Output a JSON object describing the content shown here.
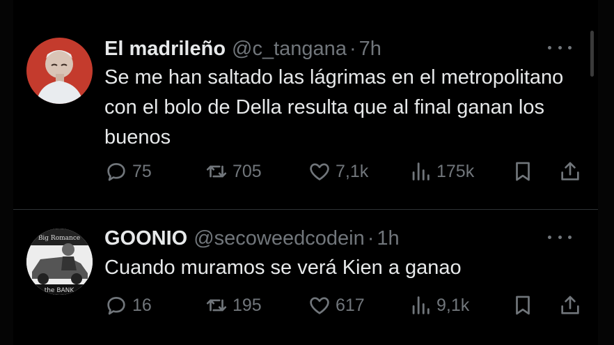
{
  "tweets": [
    {
      "name": "El madrileño",
      "handle": "@c_tangana",
      "separator": "·",
      "time": "7h",
      "text": "Se me han saltado las lágrimas en el metropolitano con el bolo de Della resulta que al final ganan los buenos",
      "replies": "75",
      "retweets": "705",
      "likes": "7,1k",
      "views": "175k"
    },
    {
      "name": "GOONIO",
      "handle": "@secoweedcodein",
      "separator": "·",
      "time": "1h",
      "text": "Cuando muramos se verá Kien a ganao",
      "avatar_text_top": "Big Romance",
      "avatar_text_bottom": "the BANK",
      "replies": "16",
      "retweets": "195",
      "likes": "617",
      "views": "9,1k"
    }
  ],
  "colors": {
    "background": "#000000",
    "text": "#e7e9ea",
    "muted": "#71767b",
    "divider": "#2f3336"
  }
}
